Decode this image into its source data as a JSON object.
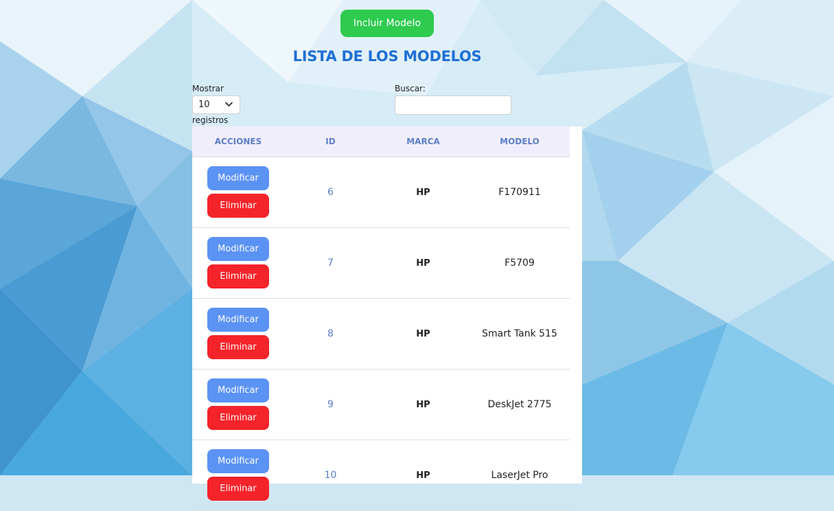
{
  "header": {
    "add_button": "Incluir Modelo",
    "title": "LISTA DE LOS MODELOS"
  },
  "controls": {
    "show_label": "Mostrar",
    "show_value": "10",
    "show_suffix": "registros",
    "search_label": "Buscar:",
    "search_value": ""
  },
  "table": {
    "columns": [
      "ACCIONES",
      "ID",
      "MARCA",
      "MODELO"
    ],
    "modify_label": "Modificar",
    "delete_label": "Eliminar",
    "rows": [
      {
        "id": "6",
        "marca": "HP",
        "modelo": "F170911"
      },
      {
        "id": "7",
        "marca": "HP",
        "modelo": "F5709"
      },
      {
        "id": "8",
        "marca": "HP",
        "modelo": "Smart Tank 515"
      },
      {
        "id": "9",
        "marca": "HP",
        "modelo": "DeskJet 2775"
      },
      {
        "id": "10",
        "marca": "HP",
        "modelo": "LaserJet Pro"
      }
    ]
  },
  "colors": {
    "add_button": "#2ecb4f",
    "title": "#1f6fd6",
    "modify_button": "#5b93f5",
    "delete_button": "#f5232a",
    "header_bg": "#f1eefc",
    "header_text": "#5b7fc8"
  },
  "icons": {
    "select_chevron": "chevron-down-icon"
  }
}
